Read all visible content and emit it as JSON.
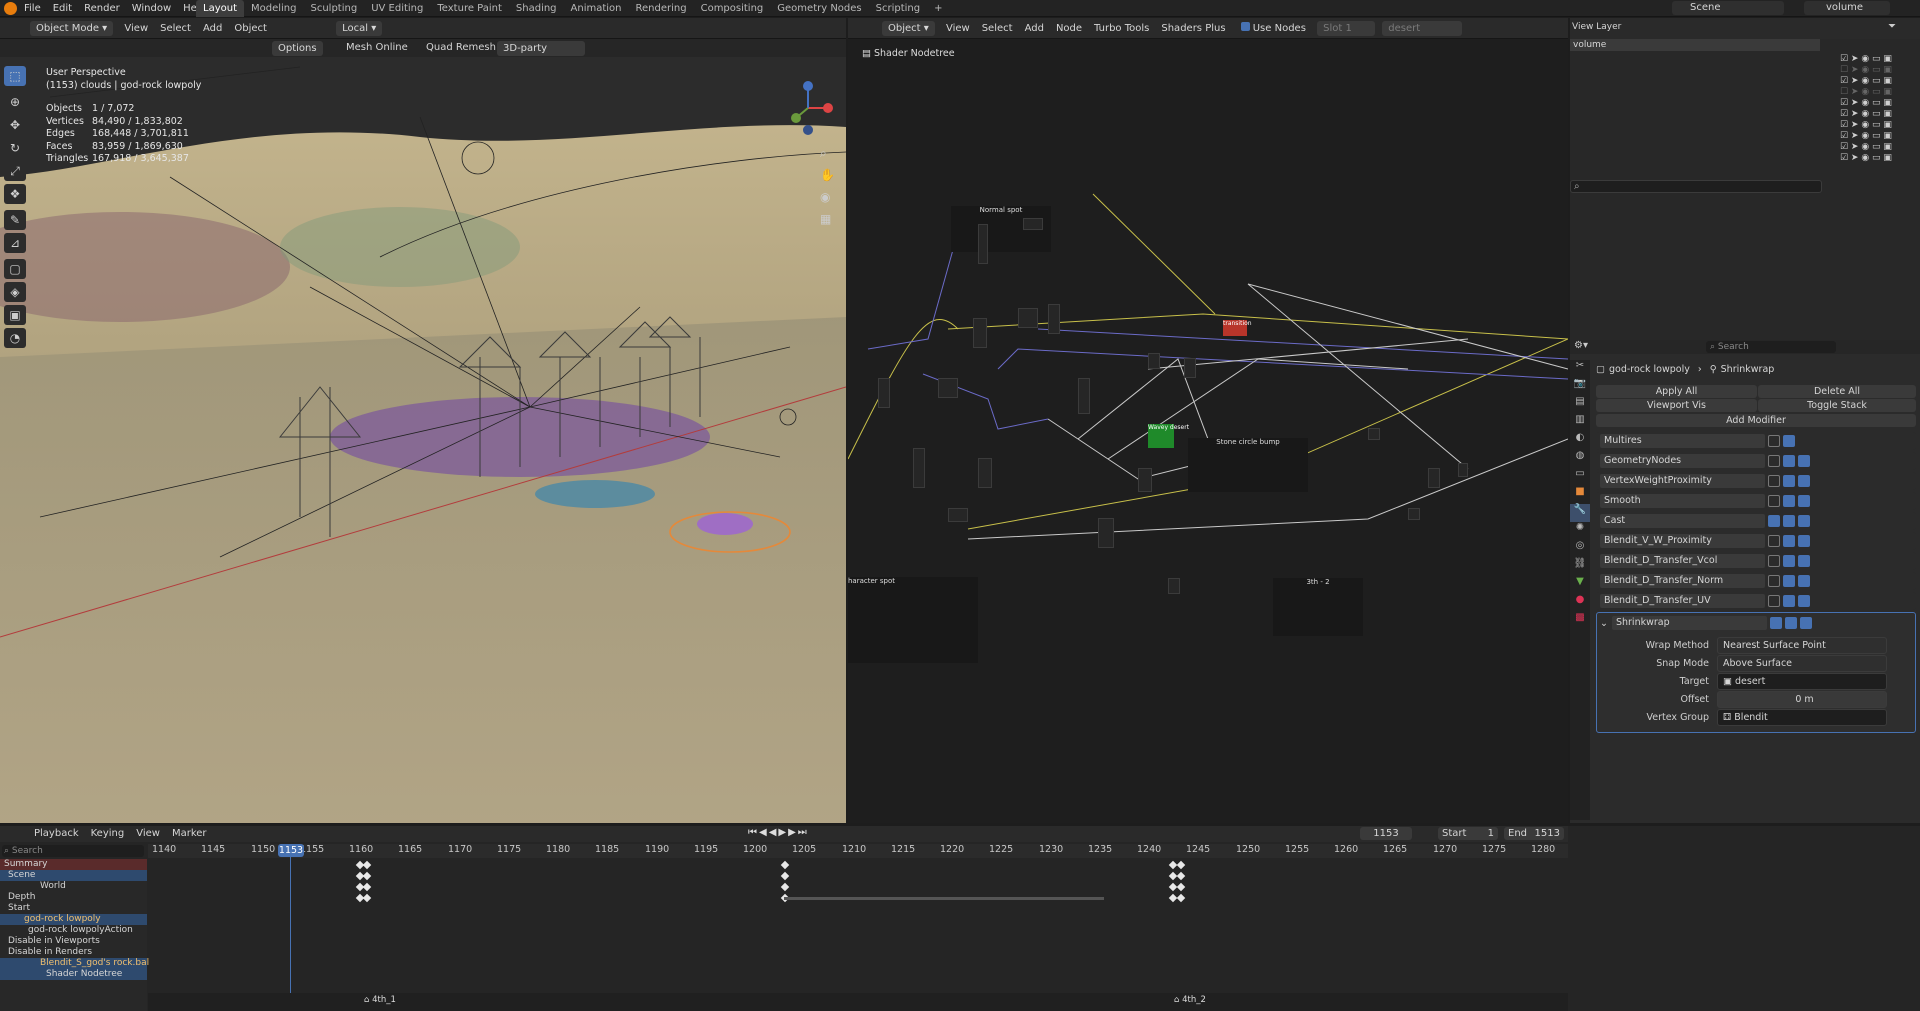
{
  "topbar": {
    "menus": [
      "File",
      "Edit",
      "Render",
      "Window",
      "Help"
    ],
    "workspaces": [
      "Layout",
      "Modeling",
      "Sculpting",
      "UV Editing",
      "Texture Paint",
      "Shading",
      "Animation",
      "Rendering",
      "Compositing",
      "Geometry Nodes",
      "Scripting"
    ],
    "active_workspace": "Layout",
    "scene": "Scene",
    "view_layer": "volume"
  },
  "viewport": {
    "mode": "Object Mode",
    "menus": [
      "View",
      "Select",
      "Add",
      "Object"
    ],
    "transform_orientation": "Local",
    "subheader": [
      "Options",
      "Mesh Online",
      "Quad Remesh",
      "3D-party"
    ],
    "perspective": "User Perspective",
    "object_line": "(1153) clouds | god-rock lowpoly",
    "stats": [
      {
        "k": "Objects",
        "v": "1 / 7,072"
      },
      {
        "k": "Vertices",
        "v": "84,490 / 1,833,802"
      },
      {
        "k": "Edges",
        "v": "168,448 / 3,701,811"
      },
      {
        "k": "Faces",
        "v": "83,959 / 1,869,630"
      },
      {
        "k": "Triangles",
        "v": "167,918 / 3,645,387"
      }
    ]
  },
  "node_editor": {
    "type": "Object",
    "menus": [
      "View",
      "Select",
      "Add",
      "Node",
      "Turbo Tools",
      "Shaders Plus"
    ],
    "use_nodes": "Use Nodes",
    "slot": "Slot 1",
    "material": "desert",
    "breadcrumb": "Shader Nodetree",
    "frames": [
      "Normal spot",
      "transition",
      "Wavey desert",
      "Stone circle bump",
      "haracter spot",
      "3th - 2"
    ]
  },
  "outliner": {
    "view_layer_label": "View Layer",
    "view_layer_value": "volume"
  },
  "properties": {
    "search_placeholder": "Search",
    "object": "god-rock lowpoly",
    "modifier_label": "Shrinkwrap",
    "apply_all": "Apply All",
    "delete_all": "Delete All",
    "viewport_vis": "Viewport Vis",
    "toggle_stack": "Toggle Stack",
    "add_modifier": "Add Modifier",
    "modifiers": [
      "Multires",
      "GeometryNodes",
      "VertexWeightProximity",
      "Smooth",
      "Cast",
      "Blendit_V_W_Proximity",
      "Blendit_D_Transfer_Vcol",
      "Blendit_D_Transfer_Norm",
      "Blendit_D_Transfer_UV",
      "Shrinkwrap"
    ],
    "shrinkwrap": {
      "wrap_method_label": "Wrap Method",
      "wrap_method": "Nearest Surface Point",
      "snap_mode_label": "Snap Mode",
      "snap_mode": "Above Surface",
      "target_label": "Target",
      "target": "desert",
      "offset_label": "Offset",
      "offset": "0 m",
      "vertex_group_label": "Vertex Group",
      "vertex_group": "Blendit"
    }
  },
  "timeline": {
    "menus": [
      "Playback",
      "Keying",
      "View",
      "Marker"
    ],
    "current_frame": "1153",
    "start_label": "Start",
    "start": "1",
    "end_label": "End",
    "end": "1513",
    "search_placeholder": "Search",
    "ticks": [
      "1140",
      "1145",
      "1150",
      "1155",
      "1160",
      "1165",
      "1170",
      "1175",
      "1180",
      "1185",
      "1190",
      "1195",
      "1200",
      "1205",
      "1210",
      "1215",
      "1220",
      "1225",
      "1230",
      "1235",
      "1240",
      "1245",
      "1250",
      "1255",
      "1260",
      "1265",
      "1270",
      "1275",
      "1280"
    ],
    "channels": [
      "Summary",
      "Scene",
      "World",
      "Depth",
      "Start",
      "god-rock lowpoly",
      "god-rock lowpolyAction",
      "Disable in Viewports",
      "Disable in Renders",
      "Blendit_S_god's rock.bal",
      "Shader Nodetree"
    ],
    "markers": [
      "4th_1",
      "4th_2"
    ]
  },
  "colors": {
    "accent": "#4772b3",
    "selection": "#e5893a",
    "header": "#2a2a2a"
  }
}
